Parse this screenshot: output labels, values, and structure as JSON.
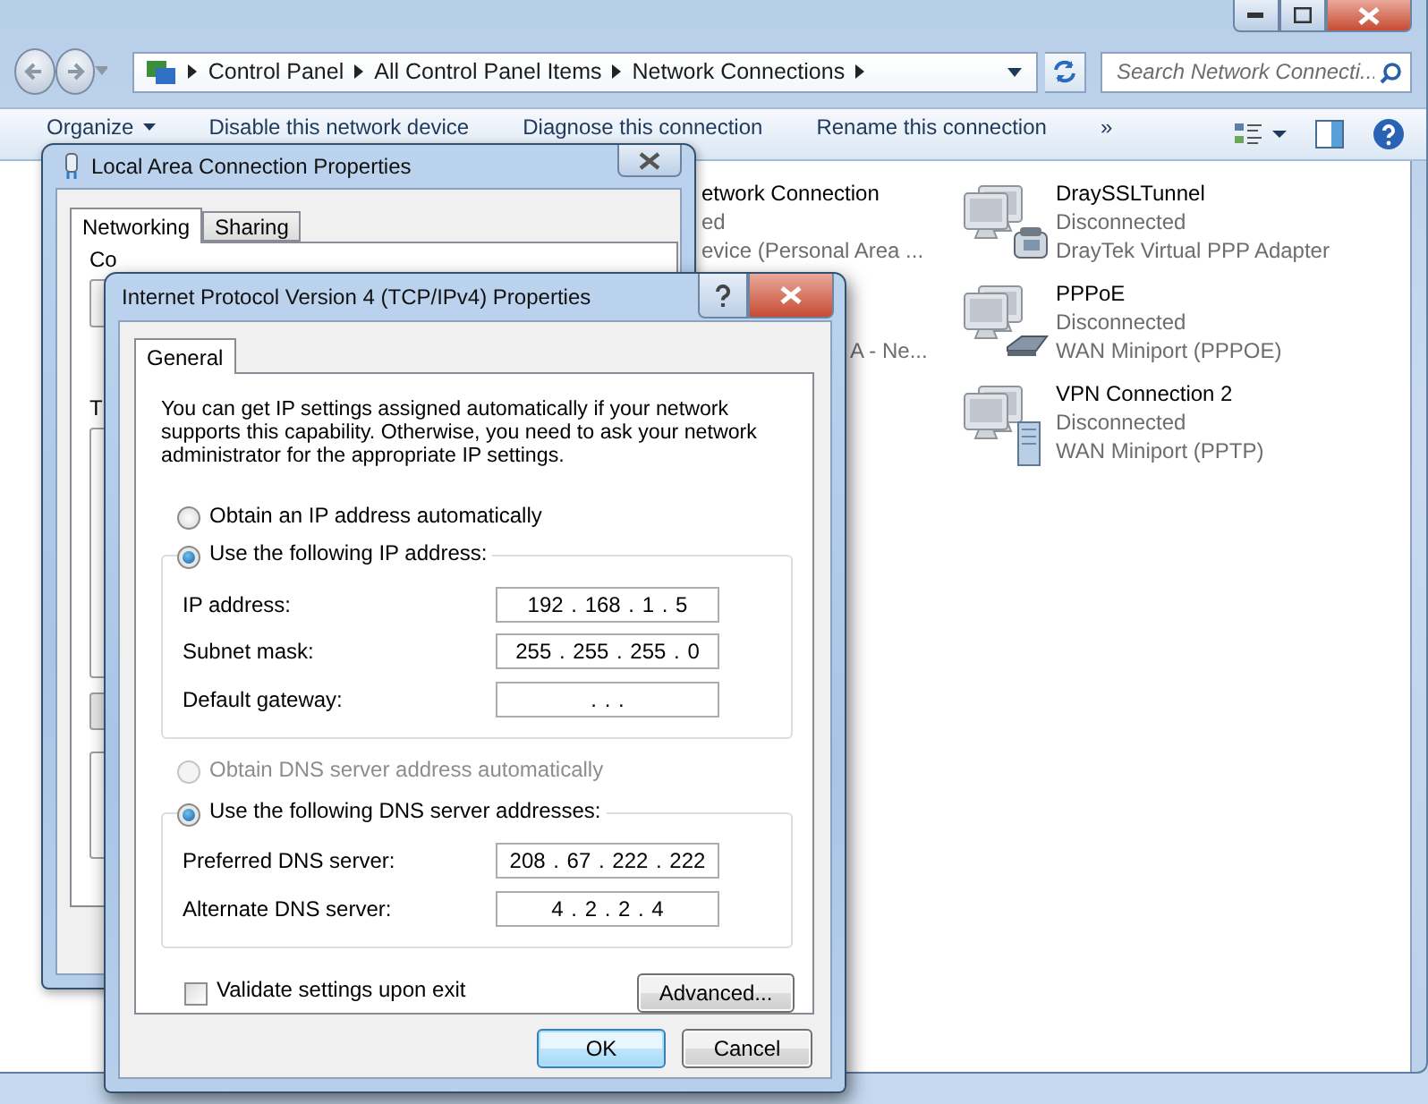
{
  "explorer": {
    "breadcrumbs": [
      "Control Panel",
      "All Control Panel Items",
      "Network Connections"
    ],
    "search": {
      "placeholder": "Search Network Connecti..."
    },
    "toolbar": [
      {
        "label": "Organize",
        "kind": "menu"
      },
      {
        "label": "Disable this network device",
        "kind": "plain"
      },
      {
        "label": "Diagnose this connection",
        "kind": "plain"
      },
      {
        "label": "Rename this connection",
        "kind": "plain"
      },
      {
        "label": "»",
        "kind": "plain"
      }
    ],
    "partial_connections": [
      {
        "name": "etwork Connection",
        "status": "ed",
        "device": "evice (Personal Area ..."
      },
      {
        "device": "A - Ne..."
      }
    ],
    "connections": [
      {
        "name": "DraySSLTunnel",
        "status": "Disconnected",
        "device": "DrayTek Virtual PPP Adapter",
        "kind": "phone"
      },
      {
        "name": "PPPoE",
        "status": "Disconnected",
        "device": "WAN Miniport (PPPOE)",
        "kind": "modem"
      },
      {
        "name": "VPN Connection 2",
        "status": "Disconnected",
        "device": "WAN Miniport (PPTP)",
        "kind": "server"
      }
    ]
  },
  "local_dialog": {
    "title": "Local Area Connection Properties",
    "tabs": [
      {
        "label": "Networking",
        "selected": true
      },
      {
        "label": "Sharing",
        "selected": false
      }
    ],
    "partial_labels": [
      "Co",
      "T"
    ]
  },
  "ipv4_dialog": {
    "title": "Internet Protocol Version 4 (TCP/IPv4) Properties",
    "tabs": [
      {
        "label": "General",
        "selected": true
      }
    ],
    "intro": "You can get IP settings assigned automatically if your network supports this capability. Otherwise, you need to ask your network administrator for the appropriate IP settings.",
    "ip_options": [
      {
        "label": "Obtain an IP address automatically",
        "selected": false,
        "disabled": false
      },
      {
        "label": "Use the following IP address:",
        "selected": true,
        "disabled": false
      }
    ],
    "ip_fields": [
      {
        "label": "IP address:",
        "value": "192 . 168 . 1 . 5"
      },
      {
        "label": "Subnet mask:",
        "value": "255 . 255 . 255 . 0"
      },
      {
        "label": "Default gateway:",
        "value": ". . ."
      }
    ],
    "dns_options": [
      {
        "label": "Obtain DNS server address automatically",
        "selected": false,
        "disabled": true
      },
      {
        "label": "Use the following DNS server addresses:",
        "selected": true,
        "disabled": false
      }
    ],
    "dns_fields": [
      {
        "label": "Preferred DNS server:",
        "value": "208 . 67 . 222 . 222"
      },
      {
        "label": "Alternate DNS server:",
        "value": "4 . 2 . 2 . 4"
      }
    ],
    "validate": {
      "label": "Validate settings upon exit",
      "checked": false
    },
    "advanced": {
      "label": "Advanced...",
      "default": false
    },
    "buttons": [
      {
        "label": "OK",
        "default": true
      },
      {
        "label": "Cancel",
        "default": false
      }
    ]
  }
}
